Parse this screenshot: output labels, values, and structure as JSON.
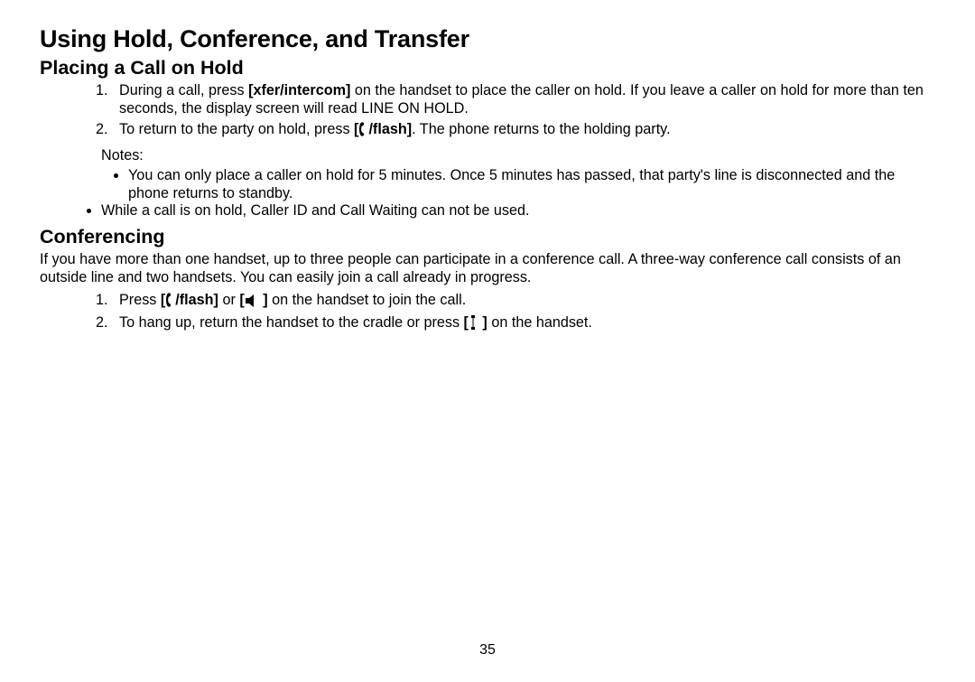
{
  "page": {
    "title": "Using Hold, Conference, and Transfer",
    "number": "35"
  },
  "hold": {
    "heading": "Placing a Call on Hold",
    "step1_a": "During a call, press ",
    "step1_b": "[xfer/intercom]",
    "step1_c": " on the handset to place the caller on hold. If you leave a caller on hold for more than ten seconds, the display screen will read LINE ON HOLD.",
    "step2_a": "To return to the party on hold, press ",
    "step2_b": "[",
    "step2_c": "/flash]",
    "step2_d": ". The phone returns to the holding party.",
    "notes_label": "Notes:",
    "note1": "You can only place a caller on hold for 5 minutes. Once 5 minutes has passed, that party's line is disconnected and the phone returns to standby.",
    "note2": "While a call is on hold, Caller ID and Call Waiting can not be used."
  },
  "conf": {
    "heading": "Conferencing",
    "intro": "If you have more than one handset, up to three people can participate in a conference call. A three-way conference call consists of an outside line and two handsets. You can easily join a call already in progress.",
    "step1_a": "Press ",
    "step1_b": "[",
    "step1_c": "/flash]",
    "step1_d": " or ",
    "step1_e": "[",
    "step1_f": " ]",
    "step1_g": " on the handset to join the call.",
    "step2_a": "To hang up, return the handset to the cradle or press ",
    "step2_b": "[",
    "step2_c": " ]",
    "step2_d": " on the handset."
  }
}
